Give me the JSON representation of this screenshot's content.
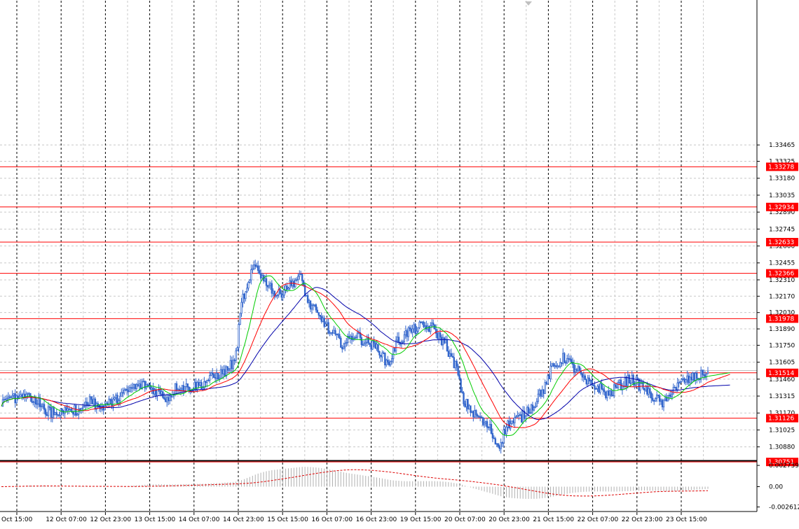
{
  "chart_data": {
    "type": "candlestick",
    "main_axis": {
      "ylim": [
        1.3077,
        1.347
      ],
      "ticks": [
        1.33465,
        1.33325,
        1.3318,
        1.33035,
        1.3289,
        1.32745,
        1.326,
        1.32455,
        1.3231,
        1.3217,
        1.3203,
        1.3189,
        1.3175,
        1.31605,
        1.3146,
        1.31315,
        1.3117,
        1.31025,
        1.3088
      ],
      "grid": true
    },
    "levels": [
      {
        "value": 1.33278,
        "label": "1.33278"
      },
      {
        "value": 1.32934,
        "label": "1.32934"
      },
      {
        "value": 1.32633,
        "label": "1.32633"
      },
      {
        "value": 1.32366,
        "label": "1.32366"
      },
      {
        "value": 1.31978,
        "label": "1.31978"
      },
      {
        "value": 1.31514,
        "label": "1.31514"
      },
      {
        "value": 1.31126,
        "label": "1.31126"
      },
      {
        "value": 1.30751,
        "label": "1.30751"
      }
    ],
    "current_price": 1.31534,
    "date_labels": [
      "Oct 15:00",
      "12 Oct 07:00",
      "12 Oct 23:00",
      "13 Oct 15:00",
      "14 Oct 07:00",
      "14 Oct 23:00",
      "15 Oct 15:00",
      "16 Oct 07:00",
      "16 Oct 23:00",
      "19 Oct 15:00",
      "20 Oct 07:00",
      "20 Oct 23:00",
      "21 Oct 15:00",
      "22 Oct 07:00",
      "22 Oct 23:00",
      "23 Oct 15:00"
    ],
    "price_anchors": [
      [
        0,
        1.3126
      ],
      [
        1,
        1.313
      ],
      [
        2,
        1.3131
      ],
      [
        3,
        1.3129
      ],
      [
        4,
        1.3119
      ],
      [
        5,
        1.3116
      ],
      [
        6,
        1.3121
      ],
      [
        7,
        1.3119
      ],
      [
        8,
        1.3127
      ],
      [
        9,
        1.3122
      ],
      [
        10,
        1.3126
      ],
      [
        11,
        1.3133
      ],
      [
        12,
        1.3139
      ],
      [
        13,
        1.3141
      ],
      [
        14,
        1.3136
      ],
      [
        15,
        1.313
      ],
      [
        16,
        1.314
      ],
      [
        17,
        1.3139
      ],
      [
        18,
        1.3141
      ],
      [
        19,
        1.3147
      ],
      [
        20,
        1.3151
      ],
      [
        21,
        1.3159
      ],
      [
        22,
        1.3218
      ],
      [
        23,
        1.3243
      ],
      [
        24,
        1.3229
      ],
      [
        25,
        1.3218
      ],
      [
        26,
        1.3226
      ],
      [
        27,
        1.3233
      ],
      [
        28,
        1.3209
      ],
      [
        29,
        1.3197
      ],
      [
        30,
        1.3184
      ],
      [
        31,
        1.3176
      ],
      [
        32,
        1.3184
      ],
      [
        33,
        1.3178
      ],
      [
        34,
        1.3173
      ],
      [
        35,
        1.316
      ],
      [
        36,
        1.3179
      ],
      [
        37,
        1.3187
      ],
      [
        38,
        1.3191
      ],
      [
        39,
        1.319
      ],
      [
        40,
        1.3179
      ],
      [
        41,
        1.316
      ],
      [
        42,
        1.3125
      ],
      [
        43,
        1.3115
      ],
      [
        44,
        1.3106
      ],
      [
        45,
        1.309
      ],
      [
        46,
        1.3108
      ],
      [
        47,
        1.3113
      ],
      [
        48,
        1.3122
      ],
      [
        49,
        1.3136
      ],
      [
        50,
        1.3156
      ],
      [
        51,
        1.3164
      ],
      [
        52,
        1.3155
      ],
      [
        53,
        1.3143
      ],
      [
        54,
        1.3139
      ],
      [
        55,
        1.3133
      ],
      [
        56,
        1.3141
      ],
      [
        57,
        1.3146
      ],
      [
        58,
        1.314
      ],
      [
        59,
        1.3131
      ],
      [
        60,
        1.3125
      ],
      [
        61,
        1.3139
      ],
      [
        62,
        1.3145
      ],
      [
        63,
        1.3148
      ],
      [
        64,
        1.3152
      ]
    ],
    "ma_colors": {
      "fast": "#00cc00",
      "medium": "#ff0000",
      "slow": "#0000aa"
    },
    "candle_color": "#3366cc",
    "oscillator": {
      "ticks": [
        0.002739,
        0.0,
        -0.002612
      ],
      "tick_labels": [
        "0.002739",
        "0.00",
        "-0.002612"
      ],
      "ylim": [
        -0.0032,
        0.0032
      ],
      "histogram_color": "#b0b0b0",
      "signal_color": "#dd0000"
    },
    "level_color": "#ff0000",
    "label_box_color": "#ff0000"
  }
}
